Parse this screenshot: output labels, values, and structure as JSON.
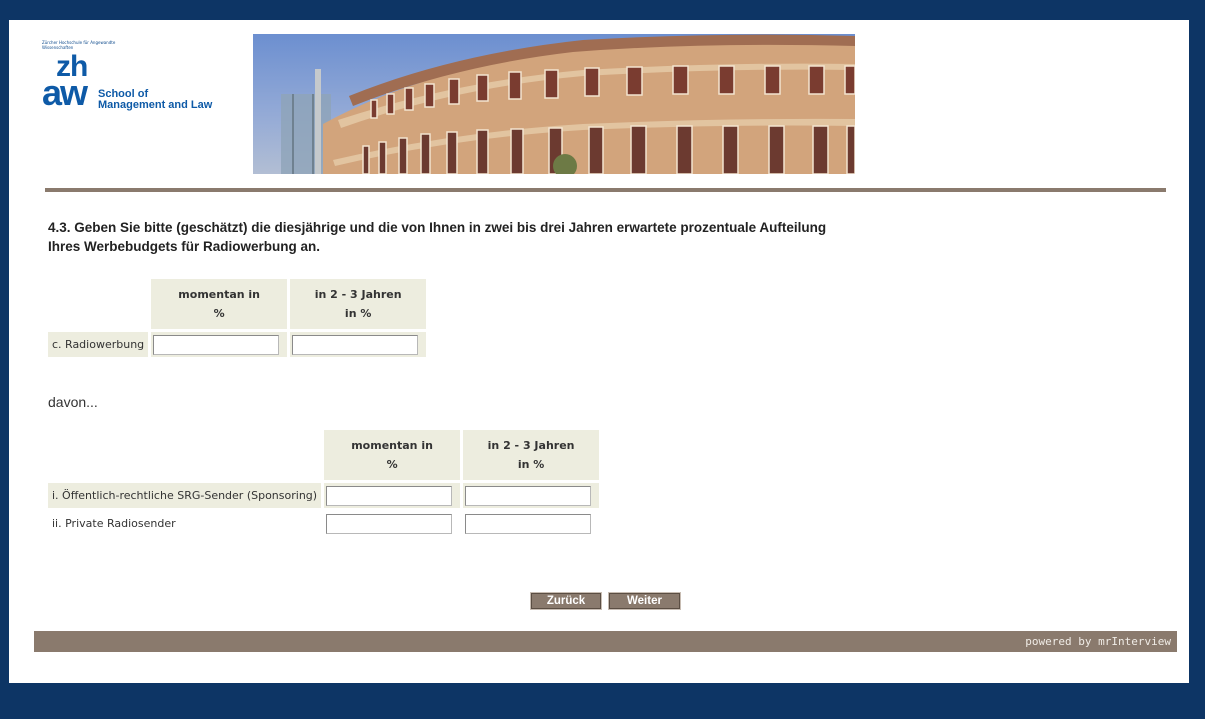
{
  "logo": {
    "small_text": "Zürcher Hochschule für Angewandte Wissenschaften",
    "zh": "zh",
    "aw": "aw",
    "school_line1": "School of",
    "school_line2": "Management and Law"
  },
  "question": {
    "line1": "4.3. Geben Sie bitte (geschätzt) die diesjährige und die von Ihnen in zwei bis drei Jahren erwartete prozentuale Aufteilung",
    "line2": "Ihres Werbebudgets für Radiowerbung an."
  },
  "table1": {
    "col1_line1": "momentan in",
    "col1_line2": "%",
    "col2_line1": "in 2 - 3 Jahren",
    "col2_line2": "in %",
    "rows": [
      {
        "label": "c. Radiowerbung",
        "value_now": "",
        "value_future": ""
      }
    ]
  },
  "davon": "davon...",
  "table2": {
    "col1_line1": "momentan in",
    "col1_line2": "%",
    "col2_line1": "in 2 - 3 Jahren",
    "col2_line2": "in %",
    "rows": [
      {
        "label": "i. Öffentlich-rechtliche SRG-Sender (Sponsoring)",
        "value_now": "",
        "value_future": ""
      },
      {
        "label": "ii. Private Radiosender",
        "value_now": "",
        "value_future": ""
      }
    ]
  },
  "buttons": {
    "back": "Zurück",
    "next": "Weiter"
  },
  "footer": {
    "powered": "powered by mrInterview"
  },
  "colors": {
    "frame": "#0d3565",
    "accent": "#8a7a6d",
    "header_bg": "#ededdf",
    "logo_blue": "#0e5aa7"
  }
}
